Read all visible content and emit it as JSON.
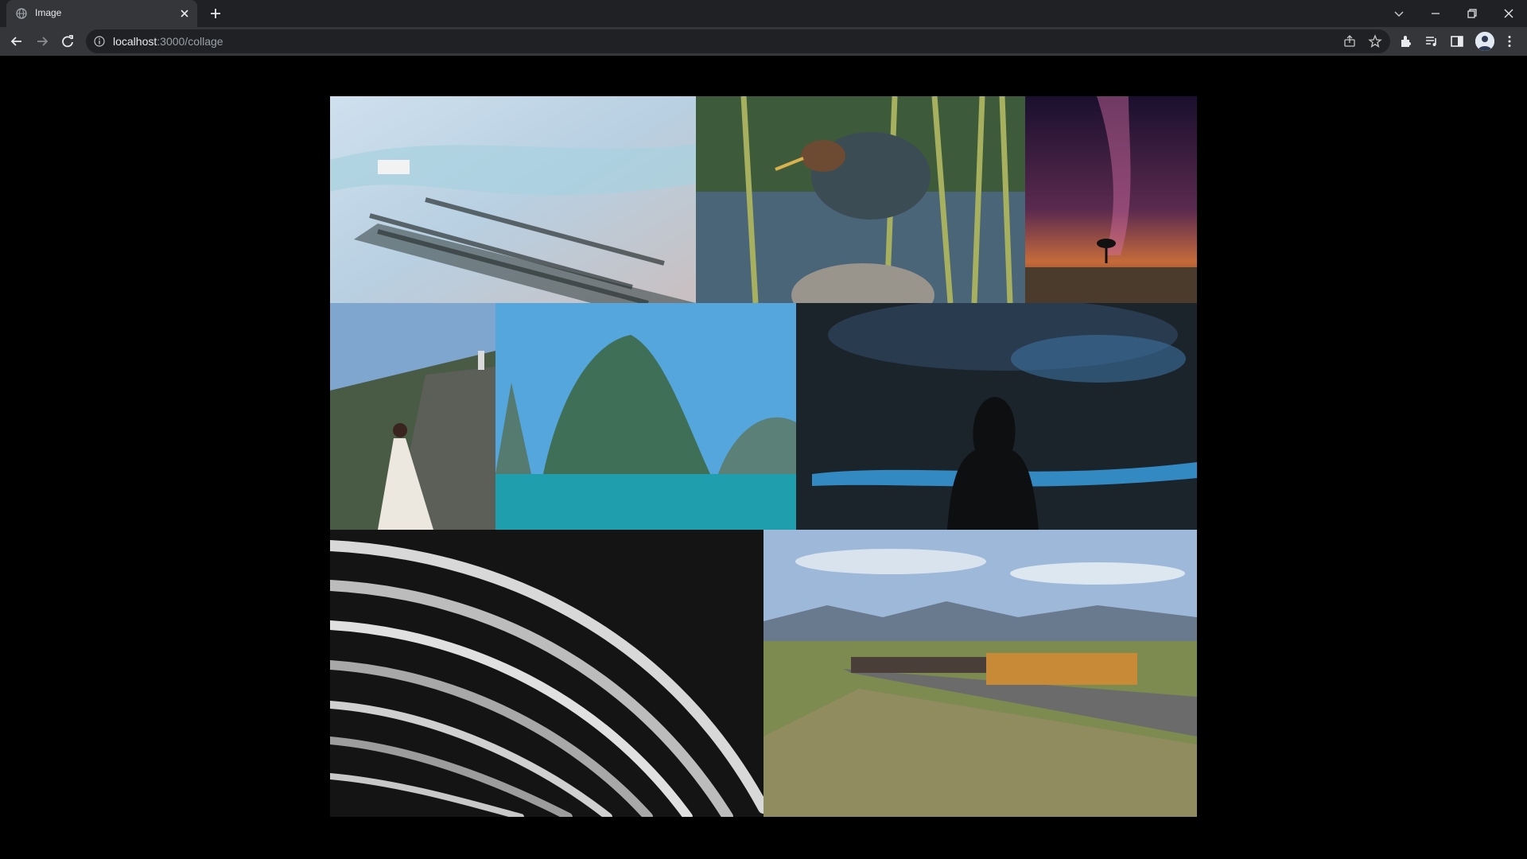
{
  "browser": {
    "tab": {
      "title": "Image",
      "favicon": "globe-icon"
    },
    "url": {
      "host": "localhost",
      "path": ":3000/collage"
    }
  },
  "collage": {
    "images": [
      {
        "id": "oyster-farm-aerial",
        "icon": "image"
      },
      {
        "id": "heron-on-rock",
        "icon": "image"
      },
      {
        "id": "milky-way-tree",
        "icon": "image"
      },
      {
        "id": "woman-mountain-pagoda",
        "icon": "image"
      },
      {
        "id": "karst-lake",
        "icon": "image"
      },
      {
        "id": "silhouette-bioluminescence",
        "icon": "image"
      },
      {
        "id": "monochrome-curves",
        "icon": "image"
      },
      {
        "id": "freight-train",
        "icon": "image"
      }
    ]
  },
  "colors": {
    "chrome_dark": "#202124",
    "chrome_mid": "#35363a",
    "page_bg": "#000000"
  }
}
